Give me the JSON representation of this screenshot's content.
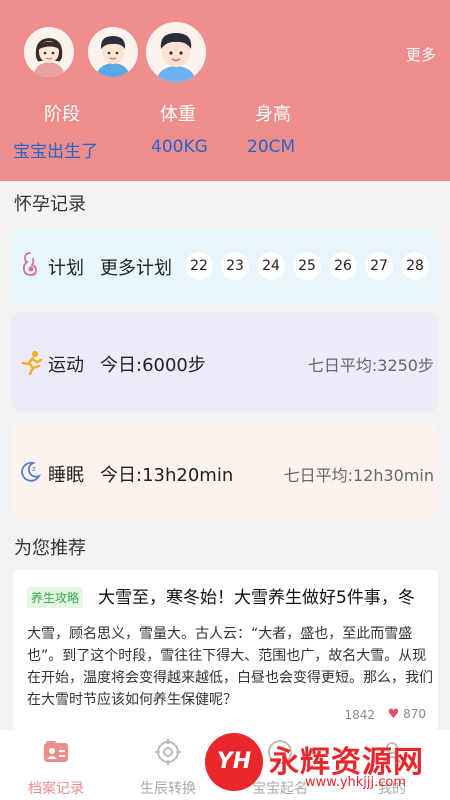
{
  "header": {
    "more_label": "更多",
    "avatars": [
      "mom-avatar",
      "dad-avatar",
      "baby-avatar"
    ],
    "stats": [
      {
        "label": "阶段",
        "value": "宝宝出生了"
      },
      {
        "label": "体重",
        "value": "400KG"
      },
      {
        "label": "身高",
        "value": "20CM"
      }
    ],
    "background_color": "#ee8e8c",
    "value_color": "#2a63c9"
  },
  "records": {
    "title": "怀孕记录",
    "plan": {
      "icon": "pregnancy-icon",
      "title": "计划",
      "more_label": "更多计划",
      "days": [
        "22",
        "23",
        "24",
        "25",
        "26",
        "27",
        "28"
      ]
    },
    "sport": {
      "icon": "running-icon",
      "title": "运动",
      "today": "今日:6000步",
      "average": "七日平均:3250步"
    },
    "sleep": {
      "icon": "moon-icon",
      "title": "睡眠",
      "today": "今日:13h20min",
      "average": "七日平均:12h30min"
    }
  },
  "recommend": {
    "title": "为您推荐",
    "article": {
      "tag": "养生攻略",
      "title": "大雪至，寒冬始！大雪养生做好5件事，冬",
      "body": "大雪，顾名思义，雪量大。古人云：“大者，盛也，至此而雪盛也”。到了这个时段，雪往往下得大、范围也广，故名大雪。从现在开始，温度将会变得越来越低，白昼也会变得更短。那么，我们在大雪时节应该如何养生保健呢？",
      "views": "1842",
      "likes": "870"
    }
  },
  "tabbar": {
    "tabs": [
      {
        "label": "档案记录",
        "icon": "profile-card-icon",
        "active": true
      },
      {
        "label": "生辰转换",
        "icon": "target-icon",
        "active": false
      },
      {
        "label": "宝宝起名",
        "icon": "name-icon",
        "active": false
      },
      {
        "label": "我的",
        "icon": "user-icon",
        "active": false
      }
    ],
    "active_color": "#ee8e8c"
  },
  "watermark": {
    "badge": "YH",
    "name": "永辉资源网",
    "url": "www.yhkjjj.com"
  }
}
